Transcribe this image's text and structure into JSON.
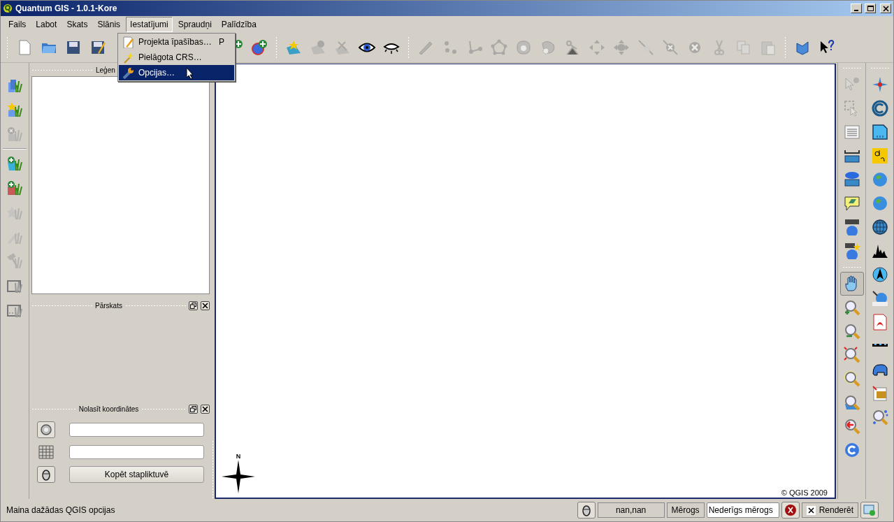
{
  "window": {
    "title": "Quantum GIS - 1.0.1-Kore"
  },
  "menu": [
    {
      "label": "Fails",
      "selected": false
    },
    {
      "label": "Labot",
      "selected": false
    },
    {
      "label": "Skats",
      "selected": false
    },
    {
      "label": "Slānis",
      "selected": false
    },
    {
      "label": "Iestatījumi",
      "selected": true
    },
    {
      "label": "Spraudņi",
      "selected": false
    },
    {
      "label": "Palīdzība",
      "selected": false
    }
  ],
  "dropdown": {
    "items": [
      {
        "label": "Projekta īpašības…",
        "shortcut": "P",
        "selected": false
      },
      {
        "label": "Pielāgota CRS…",
        "selected": false
      },
      {
        "label": "Opcijas…",
        "selected": true
      }
    ]
  },
  "legend_panel": {
    "title": "Leģen"
  },
  "overview_panel": {
    "title": "Pārskats"
  },
  "coordinates_panel": {
    "title": "Nolasīt koordinātes",
    "button": "Kopēt stapliktuvē"
  },
  "map": {
    "north_label": "N",
    "copyright": "© QGIS 2009"
  },
  "status_bar": {
    "message": "Maina dažādas QGIS opcijas",
    "coordinates": "nan,nan",
    "scale_label": "Mērogs",
    "scale_value": "Nederīgs mērogs",
    "render": {
      "label": "Renderēt",
      "checked": true
    }
  }
}
